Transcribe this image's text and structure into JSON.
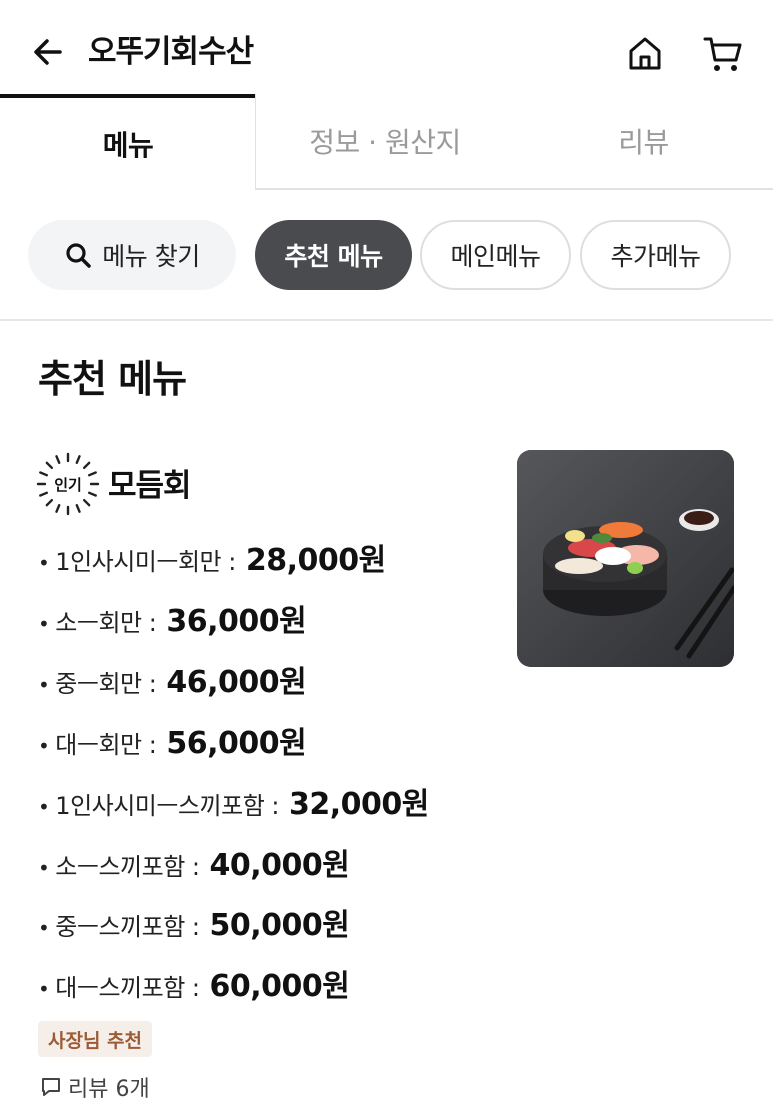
{
  "header": {
    "title": "오뚜기회수산"
  },
  "tabs": [
    {
      "label": "메뉴"
    },
    {
      "label": "정보 · 원산지"
    },
    {
      "label": "리뷰"
    }
  ],
  "chips": {
    "search": "메뉴 찾기",
    "recommended": "추천 메뉴",
    "main": "메인메뉴",
    "extra": "추가메뉴"
  },
  "section": {
    "title": "추천 메뉴"
  },
  "item": {
    "badge": "인기",
    "name": "모듬회",
    "options": [
      {
        "label": "1인사시미ㅡ회만 :",
        "price": "28,000원"
      },
      {
        "label": "소ㅡ회만 :",
        "price": "36,000원"
      },
      {
        "label": "중ㅡ회만 :",
        "price": "46,000원"
      },
      {
        "label": "대ㅡ회만 :",
        "price": "56,000원"
      },
      {
        "label": "1인사시미ㅡ스끼포함 :",
        "price": "32,000원"
      },
      {
        "label": "소ㅡ스끼포함 :",
        "price": "40,000원"
      },
      {
        "label": "중ㅡ스끼포함 :",
        "price": "50,000원"
      },
      {
        "label": "대ㅡ스끼포함 :",
        "price": "60,000원"
      }
    ],
    "owner_tag": "사장님 추천",
    "review_count": "리뷰 6개"
  },
  "icons": {
    "back": "arrow-left-icon",
    "home": "home-icon",
    "cart": "cart-icon",
    "search": "search-icon",
    "review": "speech-bubble-icon"
  },
  "colors": {
    "active_chip_bg": "#4a4b4f",
    "owner_tag_bg": "#f6efe9",
    "owner_tag_text": "#9a5b36"
  }
}
